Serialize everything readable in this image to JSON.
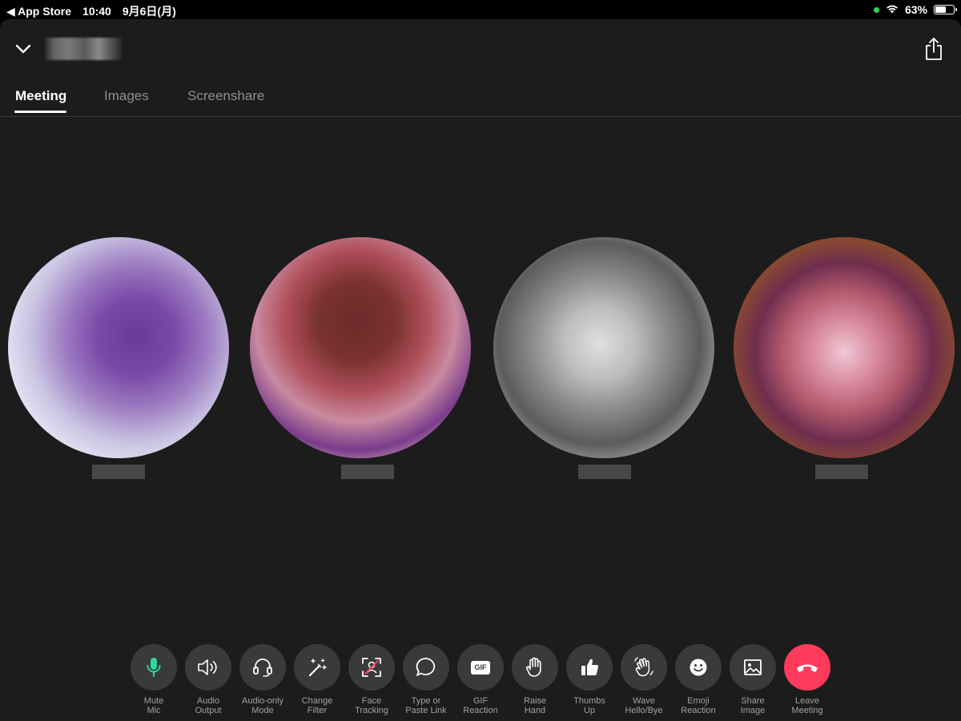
{
  "status_bar": {
    "back_app": "◀ App Store",
    "time": "10:40",
    "date": "9月6日(月)",
    "battery": "63%",
    "battery_level": 0.63,
    "mic_indicator_color": "#30d158"
  },
  "header": {
    "collapse_icon": "chevron-down-icon",
    "share_icon": "share-icon"
  },
  "tabs": [
    {
      "label": "Meeting",
      "active": true
    },
    {
      "label": "Images",
      "active": false
    },
    {
      "label": "Screenshare",
      "active": false
    }
  ],
  "participants_count": 4,
  "toolbar": [
    {
      "line1": "Mute",
      "line2": "Mic",
      "icon": "mic-icon",
      "color": "#30d5a0"
    },
    {
      "line1": "Audio",
      "line2": "Output",
      "icon": "speaker-icon"
    },
    {
      "line1": "Audio-only",
      "line2": "Mode",
      "icon": "headset-icon"
    },
    {
      "line1": "Change",
      "line2": "Filter",
      "icon": "magic-wand-icon"
    },
    {
      "line1": "Face",
      "line2": "Tracking",
      "icon": "face-tracking-icon",
      "color": "#ff3b5c"
    },
    {
      "line1": "Type or",
      "line2": "Paste Link",
      "icon": "chat-bubble-icon"
    },
    {
      "line1": "GIF",
      "line2": "Reaction",
      "icon": "gif-icon",
      "glyph": "GIF"
    },
    {
      "line1": "Raise",
      "line2": "Hand",
      "icon": "hand-icon"
    },
    {
      "line1": "Thumbs",
      "line2": "Up",
      "icon": "thumbs-up-icon"
    },
    {
      "line1": "Wave",
      "line2": "Hello/Bye",
      "icon": "wave-icon"
    },
    {
      "line1": "Emoji",
      "line2": "Reaction",
      "icon": "emoji-icon"
    },
    {
      "line1": "Share",
      "line2": "Image",
      "icon": "image-icon"
    },
    {
      "line1": "Leave",
      "line2": "Meeting",
      "icon": "phone-hangup-icon",
      "color": "#ff3b5c"
    }
  ]
}
